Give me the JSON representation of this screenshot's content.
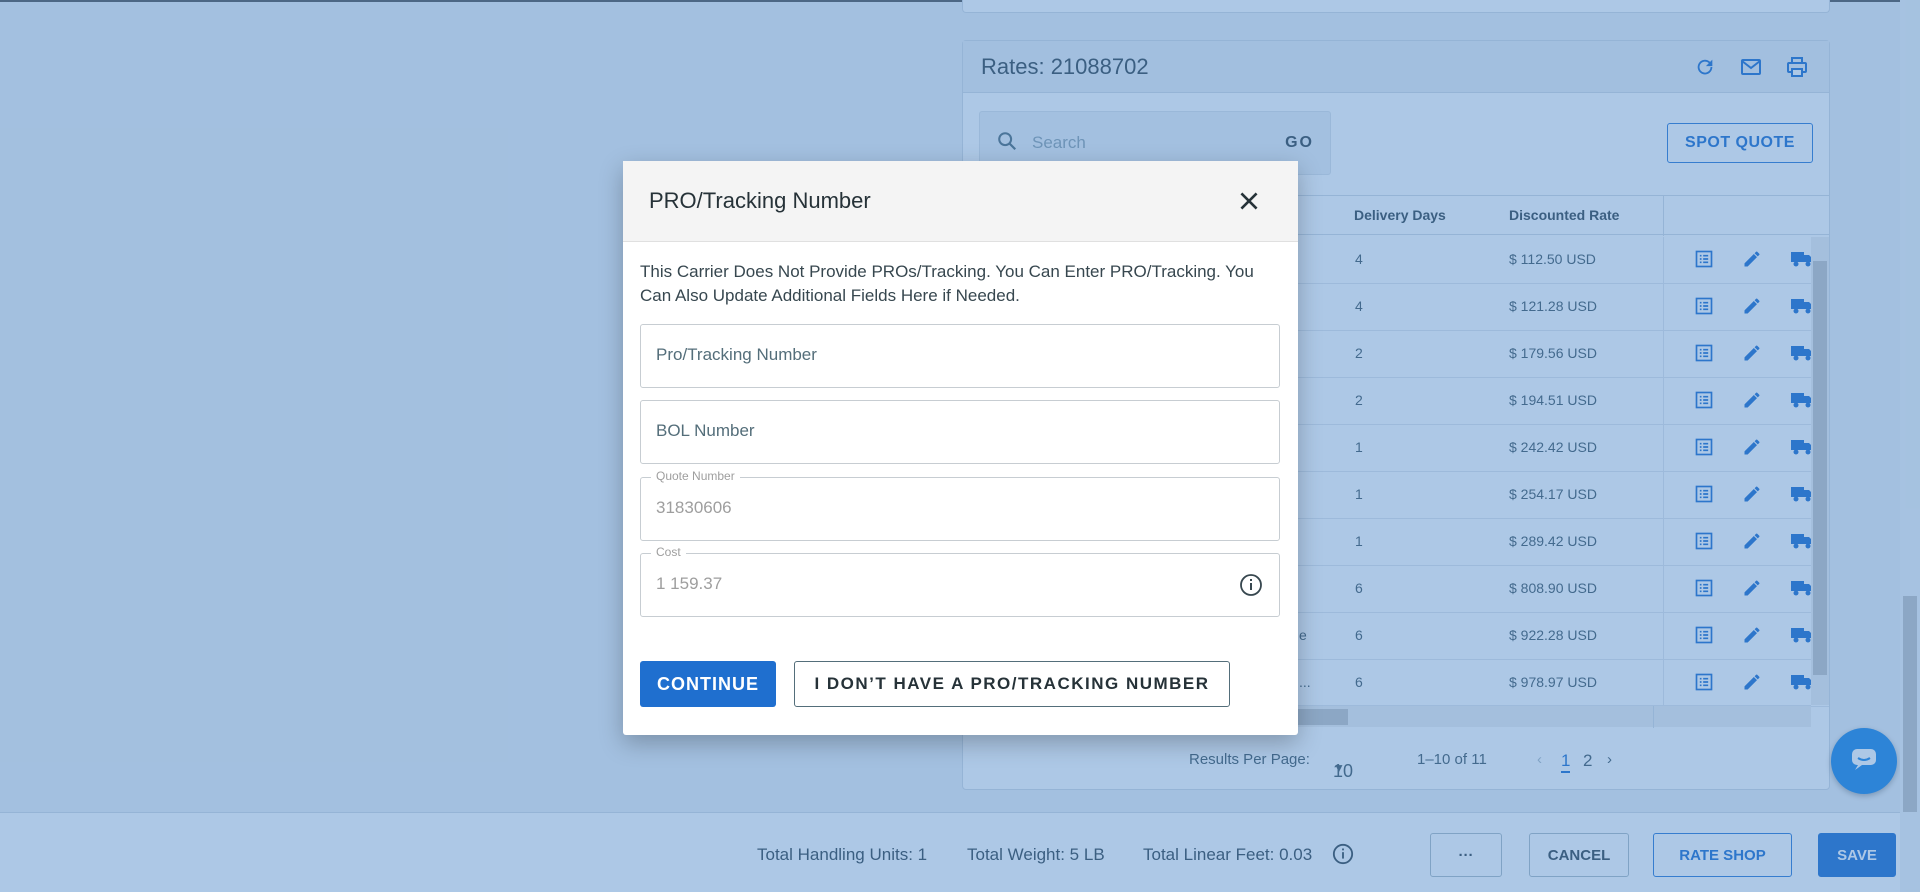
{
  "rates": {
    "title": "Rates: 21088702",
    "search_placeholder": "Search",
    "go_label": "GO",
    "spot_quote_label": "SPOT QUOTE",
    "columns": {
      "delivery_days": "Delivery Days",
      "discounted_rate": "Discounted Rate"
    },
    "rows": [
      {
        "trunc": "",
        "days": "4",
        "rate": "$ 112.50 USD"
      },
      {
        "trunc": "",
        "days": "4",
        "rate": "$ 121.28 USD"
      },
      {
        "trunc": "",
        "days": "2",
        "rate": "$ 179.56 USD"
      },
      {
        "trunc": "",
        "days": "2",
        "rate": "$ 194.51 USD"
      },
      {
        "trunc": "",
        "days": "1",
        "rate": "$ 242.42 USD"
      },
      {
        "trunc": "",
        "days": "1",
        "rate": "$ 254.17 USD"
      },
      {
        "trunc": "",
        "days": "1",
        "rate": "$ 289.42 USD"
      },
      {
        "trunc": "",
        "days": "6",
        "rate": "$ 808.90 USD"
      },
      {
        "trunc": "e",
        "days": "6",
        "rate": "$ 922.28 USD"
      },
      {
        "trunc": "...",
        "days": "6",
        "rate": "$ 978.97 USD"
      }
    ],
    "pager": {
      "results_per_page_label": "Results Per Page:",
      "per_page": "10",
      "range": "1–10 of 11",
      "page1": "1",
      "page2": "2"
    }
  },
  "footer": {
    "handling_units": "Total Handling Units: 1",
    "weight": "Total Weight: 5 LB",
    "linear_feet": "Total Linear Feet: 0.03",
    "more_label": "···",
    "cancel_label": "CANCEL",
    "rate_shop_label": "RATE SHOP",
    "save_label": "SAVE"
  },
  "dialog": {
    "title": "PRO/Tracking Number",
    "message": "This Carrier Does Not Provide PROs/Tracking. You Can Enter PRO/Tracking. You Can Also Update Additional Fields Here if Needed.",
    "pro_placeholder": "Pro/Tracking Number",
    "bol_placeholder": "BOL Number",
    "quote_label": "Quote Number",
    "quote_value": "31830606",
    "cost_label": "Cost",
    "cost_value": "1 159.37",
    "continue_label": "CONTINUE",
    "no_pro_label": "I DON’T HAVE A PRO/TRACKING NUMBER"
  },
  "colors": {
    "primary": "#1f6fcf",
    "overlay": "#4080c4"
  }
}
